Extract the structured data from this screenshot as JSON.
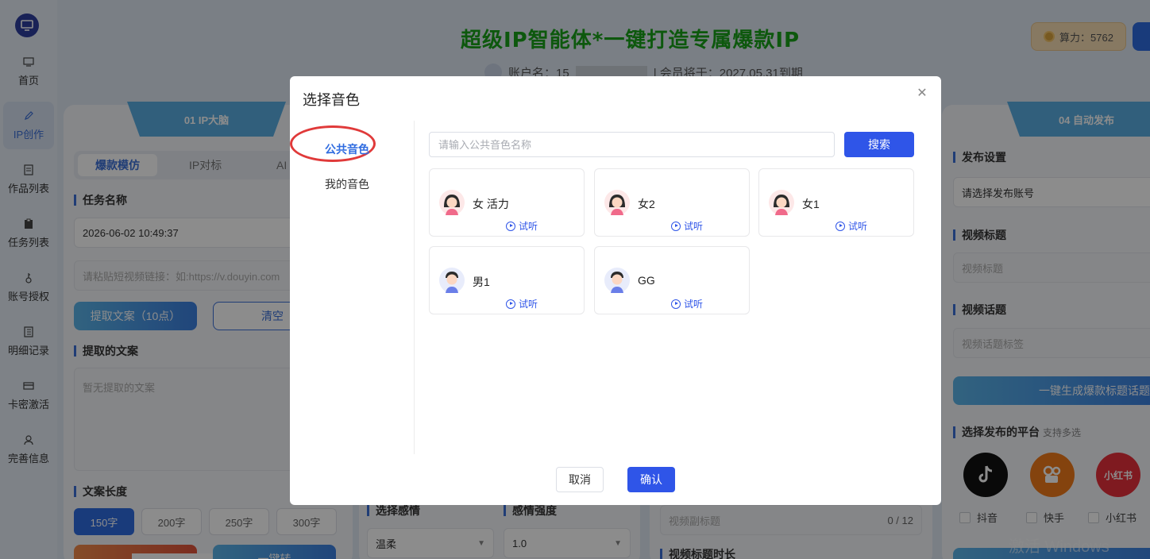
{
  "sidebar": {
    "items": [
      {
        "label": "首页",
        "icon": "monitor-icon"
      },
      {
        "label": "IP创作",
        "icon": "pen-icon"
      },
      {
        "label": "作品列表",
        "icon": "document-icon"
      },
      {
        "label": "任务列表",
        "icon": "clipboard-icon"
      },
      {
        "label": "账号授权",
        "icon": "key-icon"
      },
      {
        "label": "明细记录",
        "icon": "list-icon"
      },
      {
        "label": "卡密激活",
        "icon": "card-icon"
      },
      {
        "label": "完善信息",
        "icon": "user-icon"
      }
    ]
  },
  "header": {
    "title": "超级IP智能体*一键打造专属爆款IP",
    "account_prefix": "账户名：15",
    "account_suffix": "| 会员将于：2027.05.31到期",
    "points": "算力：5762"
  },
  "panels": {
    "p1": {
      "tab": "01 IP大脑",
      "subtabs": [
        "爆款模仿",
        "IP对标",
        "AI"
      ],
      "task_label": "任务名称",
      "task_value": "2026-06-02 10:49:37",
      "link_placeholder": "请粘贴短视频链接：如:https://v.douyin.com",
      "extract_btn": "提取文案（10点）",
      "clear_btn": "清空",
      "extracted_label": "提取的文案",
      "extracted_placeholder": "暂无提取的文案",
      "length_label": "文案长度",
      "lengths": [
        "150字",
        "200字",
        "250字",
        "300字"
      ],
      "bottom_btn_2": "一键转"
    },
    "p2": {
      "emotion_label": "选择感情",
      "emotion_value": "温柔",
      "intensity_label": "感情强度",
      "intensity_value": "1.0"
    },
    "p3": {
      "subtitle_placeholder": "视频副标题",
      "subtitle_count": "0 / 12",
      "duration_label": "视频标题时长"
    },
    "p4": {
      "tab": "04 自动发布",
      "publish_label": "发布设置",
      "account_placeholder": "请选择发布账号",
      "title_label": "视频标题",
      "title_placeholder": "视频标题",
      "topic_label": "视频话题",
      "topic_placeholder": "视频话题标签",
      "generate_btn": "一键生成爆款标题话题",
      "platform_label": "选择发布的平台",
      "platform_hint": "支持多选",
      "platforms": [
        {
          "name": "抖音",
          "icon": "douyin-icon",
          "color": "#111111"
        },
        {
          "name": "快手",
          "icon": "kuaishou-icon",
          "color": "#f07a1a"
        },
        {
          "name": "小红书",
          "icon": "xiaohongshu-icon",
          "color": "#e8313b"
        }
      ]
    }
  },
  "watermark": "激活 Windows",
  "modal": {
    "title": "选择音色",
    "nav": [
      "公共音色",
      "我的音色"
    ],
    "search_placeholder": "请输入公共音色名称",
    "search_btn": "搜索",
    "voices": [
      {
        "name": "女 活力",
        "gender": "female"
      },
      {
        "name": "女2",
        "gender": "female"
      },
      {
        "name": "女1",
        "gender": "female"
      },
      {
        "name": "男1",
        "gender": "male"
      },
      {
        "name": "GG",
        "gender": "male"
      }
    ],
    "listen_label": "试听",
    "cancel": "取消",
    "confirm": "确认"
  }
}
